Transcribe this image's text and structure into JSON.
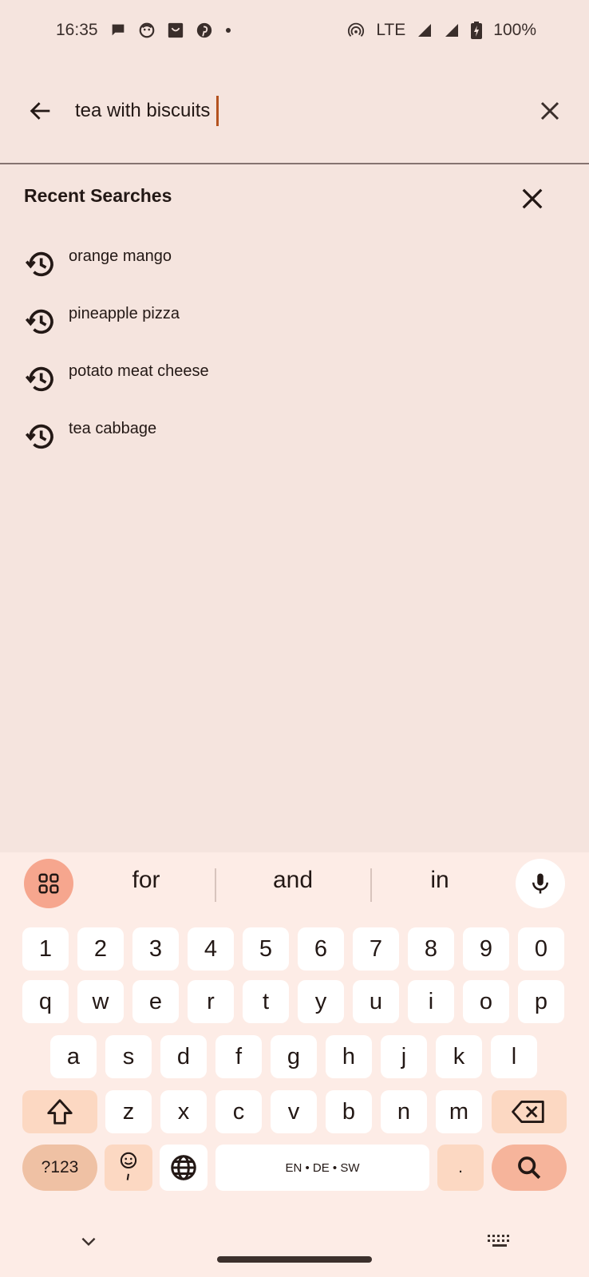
{
  "status_bar": {
    "time": "16:35",
    "network": "LTE",
    "battery": "100%",
    "left_icons": [
      "chat-icon",
      "face-icon",
      "shopping-bag-icon",
      "pinterest-icon",
      "dot-icon"
    ],
    "right_icons": [
      "hotspot-icon",
      "signal-icon",
      "signal-icon",
      "battery-icon"
    ]
  },
  "search": {
    "query": "tea with biscuits",
    "back_icon": "arrow-back-icon",
    "clear_icon": "close-icon"
  },
  "recent": {
    "title": "Recent Searches",
    "clear_icon": "close-icon",
    "items": [
      {
        "label": "orange mango",
        "icon": "history-icon"
      },
      {
        "label": "pineapple pizza",
        "icon": "history-icon"
      },
      {
        "label": "potato meat cheese",
        "icon": "history-icon"
      },
      {
        "label": "tea cabbage",
        "icon": "history-icon"
      }
    ]
  },
  "keyboard": {
    "suggestions": [
      "for",
      "and",
      "in"
    ],
    "number_row": [
      "1",
      "2",
      "3",
      "4",
      "5",
      "6",
      "7",
      "8",
      "9",
      "0"
    ],
    "row1": [
      "q",
      "w",
      "e",
      "r",
      "t",
      "y",
      "u",
      "i",
      "o",
      "p"
    ],
    "row2": [
      "a",
      "s",
      "d",
      "f",
      "g",
      "h",
      "j",
      "k",
      "l"
    ],
    "row3": [
      "z",
      "x",
      "c",
      "v",
      "b",
      "n",
      "m"
    ],
    "symbols_label": "?123",
    "space_label": "EN • DE • SW",
    "period_label": ".",
    "colors": {
      "background": "#fdece6",
      "key": "#ffffff",
      "modifier_key": "#fcd8c2",
      "accent_key": "#f6b49b"
    }
  },
  "colors": {
    "page_background": "#f5e4de",
    "cursor": "#b4521f",
    "text": "#231815"
  }
}
